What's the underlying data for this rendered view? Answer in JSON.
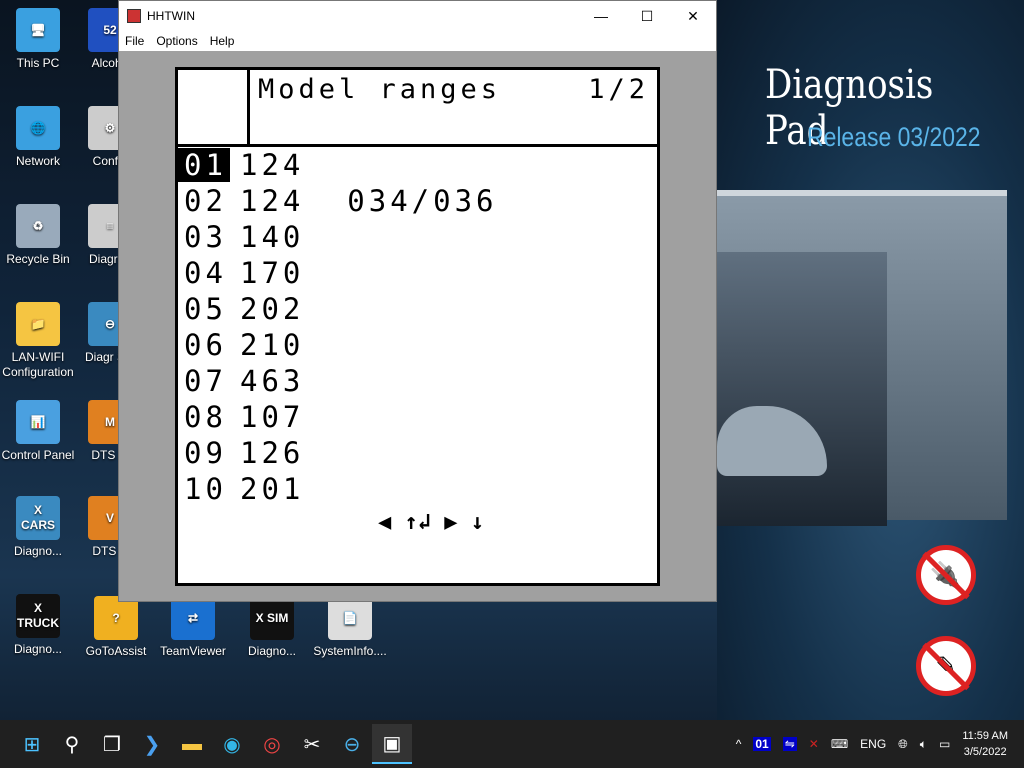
{
  "window": {
    "title": "HHTWIN",
    "menu": [
      "File",
      "Options",
      "Help"
    ],
    "controls": [
      "—",
      "☐",
      "✕"
    ]
  },
  "screen": {
    "title": "Model ranges",
    "page": "1/2",
    "rows": [
      {
        "n": "01",
        "v": "124"
      },
      {
        "n": "02",
        "v": "124  034/036"
      },
      {
        "n": "03",
        "v": "140"
      },
      {
        "n": "04",
        "v": "170"
      },
      {
        "n": "05",
        "v": "202"
      },
      {
        "n": "06",
        "v": "210"
      },
      {
        "n": "07",
        "v": "463"
      },
      {
        "n": "08",
        "v": "107"
      },
      {
        "n": "09",
        "v": "126"
      },
      {
        "n": "10",
        "v": "201"
      }
    ],
    "selected": "01",
    "nav": "◀ ↑↲ ▶ ↓"
  },
  "wallpaper": {
    "title": "Diagnosis Pad",
    "release": "Release 03/2022"
  },
  "desktop": [
    {
      "label": "This PC",
      "glyph": "🖥"
    },
    {
      "label": "Network",
      "glyph": "🌐"
    },
    {
      "label": "Recycle Bin",
      "glyph": "♻"
    },
    {
      "label": "LAN-WIFI Configuration",
      "glyph": "📁"
    },
    {
      "label": "Control Panel",
      "glyph": "📊"
    },
    {
      "label": "Diagno...",
      "glyph": "X CARS"
    },
    {
      "label": "Diagno...",
      "glyph": "X TRUCK"
    },
    {
      "label": "Alcoho",
      "glyph": "52"
    },
    {
      "label": "Config",
      "glyph": "⚙"
    },
    {
      "label": "Diagr Fi",
      "glyph": "≡"
    },
    {
      "label": "Diagr Sto",
      "glyph": "⊖"
    },
    {
      "label": "DTS M",
      "glyph": "M"
    },
    {
      "label": "DTS V",
      "glyph": "V"
    },
    {
      "label": "GoToAssist",
      "glyph": "?"
    },
    {
      "label": "TeamViewer",
      "glyph": "⇄"
    },
    {
      "label": "Diagno...",
      "glyph": "X SIM"
    },
    {
      "label": "SystemInfo....",
      "glyph": "📄"
    }
  ],
  "taskbar": {
    "lang": "ENG",
    "time": "11:59 AM",
    "date": "3/5/2022",
    "tray_badge": "01"
  }
}
